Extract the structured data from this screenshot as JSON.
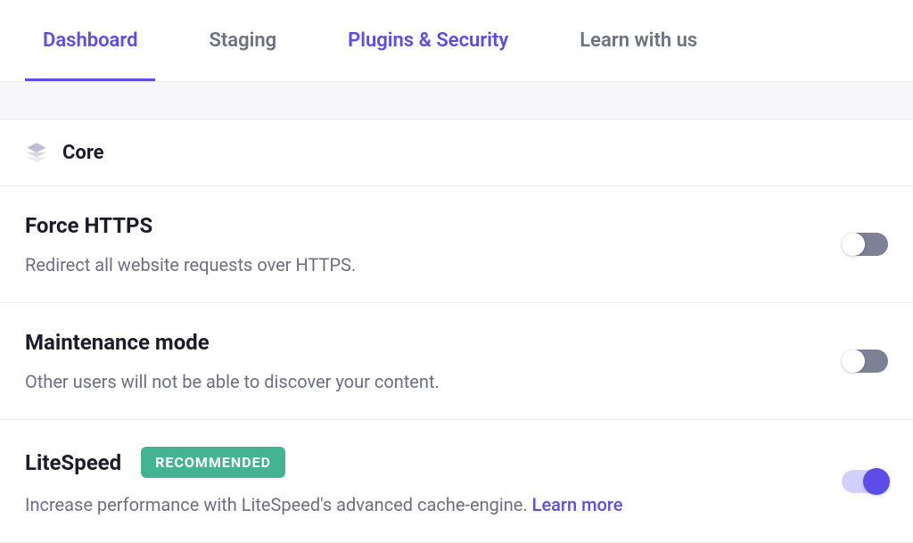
{
  "tabs": {
    "dashboard": "Dashboard",
    "staging": "Staging",
    "plugins": "Plugins & Security",
    "learn": "Learn with us"
  },
  "section": {
    "title": "Core"
  },
  "settings": {
    "https": {
      "title": "Force HTTPS",
      "desc": "Redirect all website requests over HTTPS."
    },
    "maintenance": {
      "title": "Maintenance mode",
      "desc": "Other users will not be able to discover your content."
    },
    "litespeed": {
      "title": "LiteSpeed",
      "badge": "RECOMMENDED",
      "desc": "Increase performance with LiteSpeed's advanced cache-engine. ",
      "link": "Learn more"
    }
  }
}
